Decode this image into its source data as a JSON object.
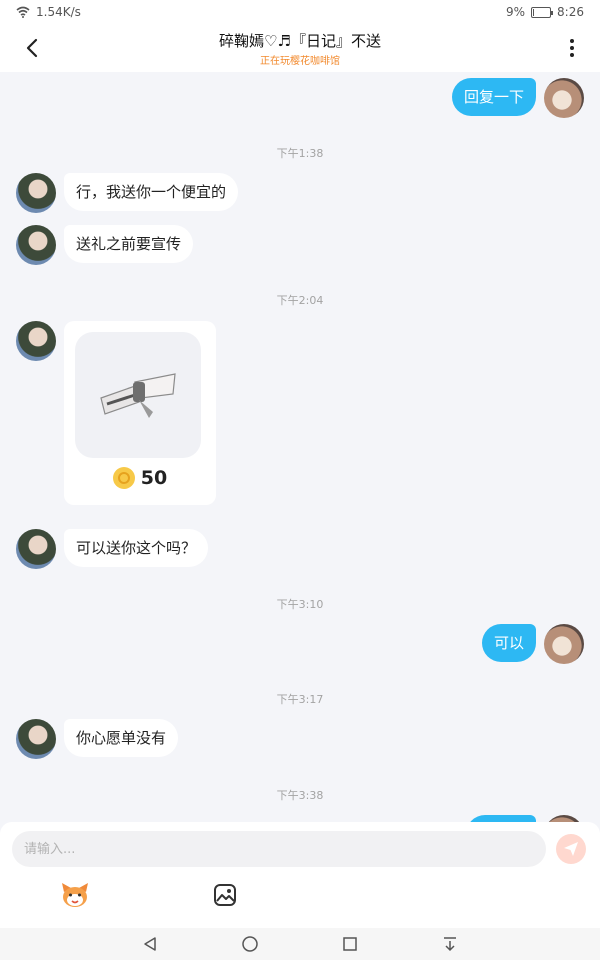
{
  "status_bar": {
    "network_speed": "1.54K/s",
    "battery_percent": "9%",
    "battery_level": 0.09,
    "time": "8:26"
  },
  "header": {
    "title": "碎鞠嫣♡♬『日记』不送",
    "subtitle": "正在玩樱花咖啡馆"
  },
  "messages": [
    {
      "type": "text",
      "from": "self",
      "text": "回复一下"
    },
    {
      "type": "time",
      "text": "下午1:38"
    },
    {
      "type": "text",
      "from": "other",
      "text": "行，我送你一个便宜的"
    },
    {
      "type": "text",
      "from": "other",
      "text": "送礼之前要宣传"
    },
    {
      "type": "time",
      "text": "下午2:04"
    },
    {
      "type": "gift",
      "from": "other",
      "price": "50"
    },
    {
      "type": "text",
      "from": "other",
      "text": "可以送你这个吗？"
    },
    {
      "type": "time",
      "text": "下午3:10"
    },
    {
      "type": "text",
      "from": "self",
      "text": "可以"
    },
    {
      "type": "time",
      "text": "下午3:17"
    },
    {
      "type": "text",
      "from": "other",
      "text": "你心愿单没有"
    },
    {
      "type": "time",
      "text": "下午3:38"
    }
  ],
  "input": {
    "placeholder": "请输入..."
  },
  "icons": {
    "back": "chevron-left-icon",
    "more": "more-vertical-icon",
    "send": "send-icon",
    "emoji": "emoji-mascot-icon",
    "image": "image-icon",
    "coin": "coin-icon",
    "nav_back": "nav-back-icon",
    "nav_home": "nav-home-icon",
    "nav_recent": "nav-recent-icon",
    "nav_notifications": "nav-pulldown-icon"
  },
  "colors": {
    "self_bubble": "#2db8f3",
    "subtitle": "#f28a2e",
    "send_button": "#ffd8cf",
    "background": "#f4f5f9"
  }
}
